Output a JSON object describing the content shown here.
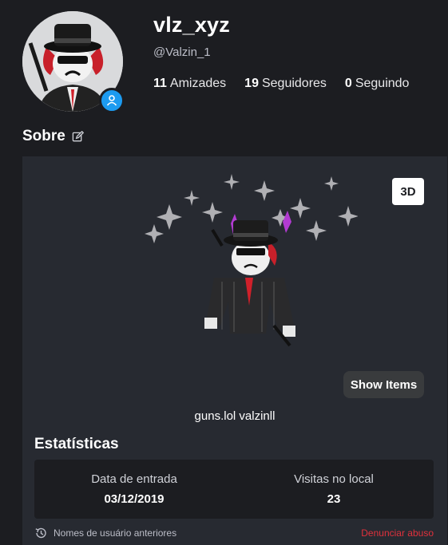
{
  "profile": {
    "display_name": "vlz_xyz",
    "username": "@Valzin_1",
    "friends_count": "11",
    "friends_label": "Amizades",
    "followers_count": "19",
    "followers_label": "Seguidores",
    "following_count": "0",
    "following_label": "Seguindo",
    "status_icon": "person-icon"
  },
  "about": {
    "title": "Sobre",
    "edit_icon": "edit-icon",
    "view_mode_label": "3D",
    "show_items_label": "Show Items",
    "bio": "guns.lol valzinll"
  },
  "stats": {
    "title": "Estatísticas",
    "join_date_label": "Data de entrada",
    "join_date_value": "03/12/2019",
    "visits_label": "Visitas no local",
    "visits_value": "23"
  },
  "footer": {
    "previous_names_label": "Nomes de usuário anteriores",
    "report_label": "Denunciar abuso"
  },
  "colors": {
    "background": "#1c1d21",
    "panel": "#272a31",
    "accent_blue": "#1c9bf0",
    "report_red": "#e0313c"
  }
}
